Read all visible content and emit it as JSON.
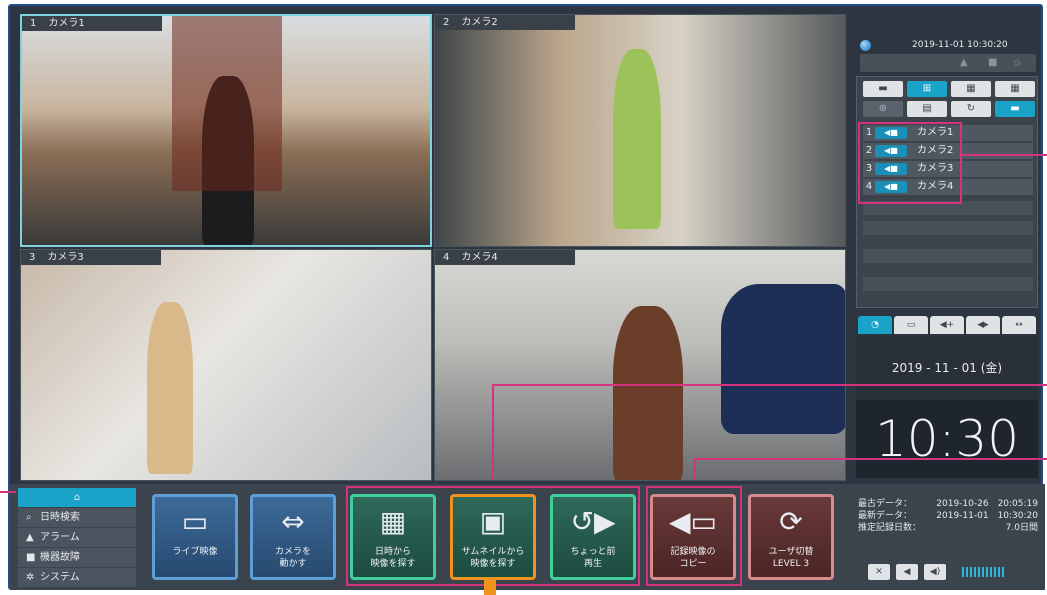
{
  "cameras": [
    {
      "num": "1",
      "name": "カメラ1"
    },
    {
      "num": "2",
      "name": "カメラ2"
    },
    {
      "num": "3",
      "name": "カメラ3"
    },
    {
      "num": "4",
      "name": "カメラ4"
    }
  ],
  "header": {
    "datetime": "2019-11-01   10:30:20"
  },
  "camera_list": [
    {
      "num": "1",
      "name": "カメラ1"
    },
    {
      "num": "2",
      "name": "カメラ2"
    },
    {
      "num": "3",
      "name": "カメラ3"
    },
    {
      "num": "4",
      "name": "カメラ4"
    }
  ],
  "date_display": "2019 - 11 - 01  (金)",
  "clock": "10:30",
  "menu": {
    "home_icon": "home-icon",
    "items": [
      "日時検索",
      "アラーム",
      "機器故障",
      "システム"
    ]
  },
  "buttons": {
    "live": "ライブ映像",
    "camera_move": "カメラを\n動かす",
    "date_search": "日時から\n映像を探す",
    "thumb_search": "サムネイルから\n映像を探す",
    "replay": "ちょっと前\n再生",
    "copy": "記録映像の\nコピー",
    "user": "ユーザ切替\nLEVEL 3"
  },
  "info": {
    "oldest_label": "最古データ：",
    "oldest_value": "2019-10-26　20:05:19",
    "newest_label": "最新データ：",
    "newest_value": "2019-11-01　10:30:20",
    "days_label": "推定記録日数：",
    "days_value": "7.0日間"
  },
  "colors": {
    "accent": "#1aa3c9",
    "highlight": "#d6327d",
    "orange": "#f0921e"
  }
}
